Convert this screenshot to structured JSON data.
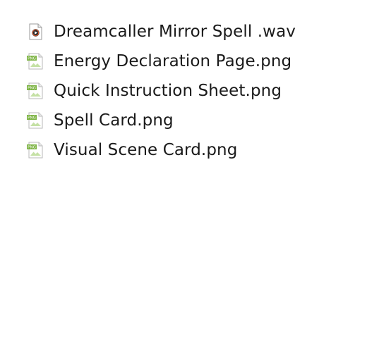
{
  "files": [
    {
      "name": "Dreamcaller Mirror Spell .wav",
      "icon": "audio-file-icon"
    },
    {
      "name": "Energy Declaration Page.png",
      "icon": "png-file-icon",
      "badge": "PNG"
    },
    {
      "name": "Quick Instruction Sheet.png",
      "icon": "png-file-icon",
      "badge": "PNG"
    },
    {
      "name": "Spell Card.png",
      "icon": "png-file-icon",
      "badge": "PNG"
    },
    {
      "name": "Visual Scene Card.png",
      "icon": "png-file-icon",
      "badge": "PNG"
    }
  ],
  "colors": {
    "text": "#1a1a1a",
    "png_badge": "#7cb342",
    "audio_accent": "#e25a2c"
  }
}
